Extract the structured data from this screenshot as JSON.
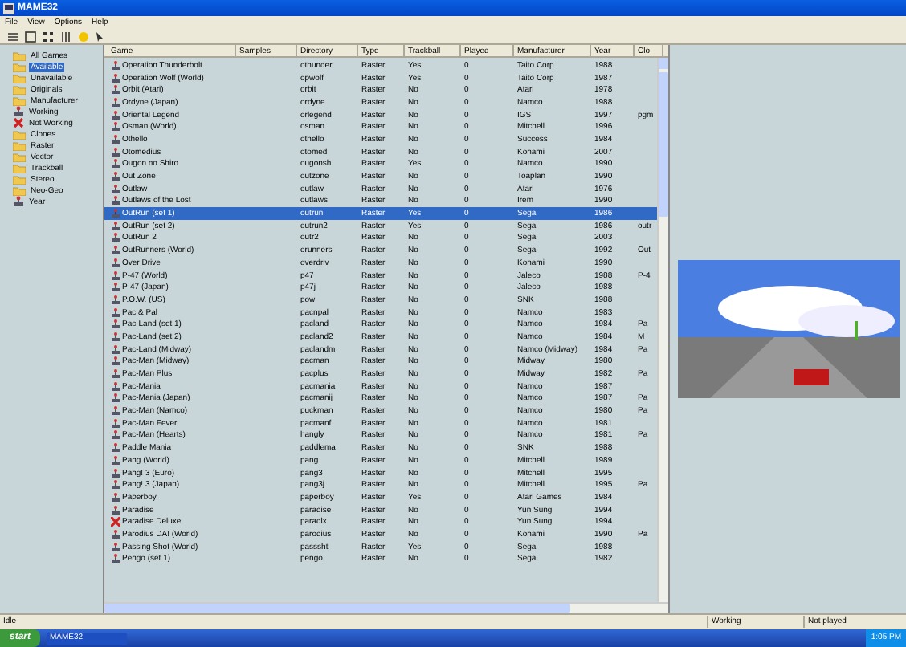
{
  "window": {
    "title": "MAME32"
  },
  "menu": [
    "File",
    "View",
    "Options",
    "Help"
  ],
  "tree": [
    {
      "label": "All Games",
      "selected": false,
      "kind": "folder"
    },
    {
      "label": "Available",
      "selected": true,
      "kind": "folder"
    },
    {
      "label": "Unavailable",
      "selected": false,
      "kind": "folder"
    },
    {
      "label": "Originals",
      "selected": false,
      "kind": "folder"
    },
    {
      "label": "Manufacturer",
      "selected": false,
      "kind": "folder"
    },
    {
      "label": "Working",
      "selected": false,
      "kind": "working"
    },
    {
      "label": "Not Working",
      "selected": false,
      "kind": "broken"
    },
    {
      "label": "Clones",
      "selected": false,
      "kind": "folder"
    },
    {
      "label": "Raster",
      "selected": false,
      "kind": "folder"
    },
    {
      "label": "Vector",
      "selected": false,
      "kind": "folder"
    },
    {
      "label": "Trackball",
      "selected": false,
      "kind": "folder"
    },
    {
      "label": "Stereo",
      "selected": false,
      "kind": "folder"
    },
    {
      "label": "Neo-Geo",
      "selected": false,
      "kind": "folder"
    },
    {
      "label": "Year",
      "selected": false,
      "kind": "working"
    }
  ],
  "columns": [
    "Game",
    "Samples",
    "Directory",
    "Type",
    "Trackball",
    "Played",
    "Manufacturer",
    "Year",
    "Clo"
  ],
  "rows": [
    {
      "game": "Operation Thunderbolt",
      "directory": "othunder",
      "type": "Raster",
      "trackball": "Yes",
      "played": "0",
      "manufacturer": "Taito Corp",
      "year": "1988",
      "kind": "working",
      "selected": false
    },
    {
      "game": "Operation Wolf (World)",
      "directory": "opwolf",
      "type": "Raster",
      "trackball": "Yes",
      "played": "0",
      "manufacturer": "Taito Corp",
      "year": "1987",
      "kind": "working",
      "selected": false
    },
    {
      "game": "Orbit (Atari)",
      "directory": "orbit",
      "type": "Raster",
      "trackball": "No",
      "played": "0",
      "manufacturer": "Atari",
      "year": "1978",
      "kind": "working",
      "selected": false
    },
    {
      "game": "Ordyne (Japan)",
      "directory": "ordyne",
      "type": "Raster",
      "trackball": "No",
      "played": "0",
      "manufacturer": "Namco",
      "year": "1988",
      "kind": "working",
      "selected": false
    },
    {
      "game": "Oriental Legend",
      "directory": "orlegend",
      "type": "Raster",
      "trackball": "No",
      "played": "0",
      "manufacturer": "IGS",
      "year": "1997",
      "clone_of": "pgm",
      "kind": "working",
      "selected": false
    },
    {
      "game": "Osman (World)",
      "directory": "osman",
      "type": "Raster",
      "trackball": "No",
      "played": "0",
      "manufacturer": "Mitchell",
      "year": "1996",
      "kind": "working",
      "selected": false
    },
    {
      "game": "Othello",
      "directory": "othello",
      "type": "Raster",
      "trackball": "No",
      "played": "0",
      "manufacturer": "Success",
      "year": "1984",
      "kind": "working",
      "selected": false
    },
    {
      "game": "Otomedius",
      "directory": "otomed",
      "type": "Raster",
      "trackball": "No",
      "played": "0",
      "manufacturer": "Konami",
      "year": "2007",
      "kind": "working",
      "selected": false
    },
    {
      "game": "Ougon no Shiro",
      "directory": "ougonsh",
      "type": "Raster",
      "trackball": "Yes",
      "played": "0",
      "manufacturer": "Namco",
      "year": "1990",
      "kind": "working",
      "selected": false
    },
    {
      "game": "Out Zone",
      "directory": "outzone",
      "type": "Raster",
      "trackball": "No",
      "played": "0",
      "manufacturer": "Toaplan",
      "year": "1990",
      "kind": "working",
      "selected": false
    },
    {
      "game": "Outlaw",
      "directory": "outlaw",
      "type": "Raster",
      "trackball": "No",
      "played": "0",
      "manufacturer": "Atari",
      "year": "1976",
      "kind": "working",
      "selected": false
    },
    {
      "game": "Outlaws of the Lost",
      "directory": "outlaws",
      "type": "Raster",
      "trackball": "No",
      "played": "0",
      "manufacturer": "Irem",
      "year": "1990",
      "kind": "working",
      "selected": false
    },
    {
      "game": "OutRun (set 1)",
      "directory": "outrun",
      "type": "Raster",
      "trackball": "Yes",
      "played": "0",
      "manufacturer": "Sega",
      "year": "1986",
      "kind": "working",
      "selected": true
    },
    {
      "game": "OutRun (set 2)",
      "directory": "outrun2",
      "type": "Raster",
      "trackball": "Yes",
      "played": "0",
      "manufacturer": "Sega",
      "year": "1986",
      "clone_of": "outr",
      "kind": "working",
      "selected": false
    },
    {
      "game": "OutRun 2",
      "directory": "outr2",
      "type": "Raster",
      "trackball": "No",
      "played": "0",
      "manufacturer": "Sega",
      "year": "2003",
      "kind": "working",
      "selected": false
    },
    {
      "game": "OutRunners (World)",
      "directory": "orunners",
      "type": "Raster",
      "trackball": "No",
      "played": "0",
      "manufacturer": "Sega",
      "year": "1992",
      "clone_of": "Out",
      "kind": "working",
      "selected": false
    },
    {
      "game": "Over Drive",
      "directory": "overdriv",
      "type": "Raster",
      "trackball": "No",
      "played": "0",
      "manufacturer": "Konami",
      "year": "1990",
      "kind": "working",
      "selected": false
    },
    {
      "game": "P-47 (World)",
      "directory": "p47",
      "type": "Raster",
      "trackball": "No",
      "played": "0",
      "manufacturer": "Jaleco",
      "year": "1988",
      "clone_of": "P-4",
      "kind": "working",
      "selected": false
    },
    {
      "game": "P-47 (Japan)",
      "directory": "p47j",
      "type": "Raster",
      "trackball": "No",
      "played": "0",
      "manufacturer": "Jaleco",
      "year": "1988",
      "kind": "working",
      "selected": false
    },
    {
      "game": "P.O.W. (US)",
      "directory": "pow",
      "type": "Raster",
      "trackball": "No",
      "played": "0",
      "manufacturer": "SNK",
      "year": "1988",
      "kind": "working",
      "selected": false
    },
    {
      "game": "Pac & Pal",
      "directory": "pacnpal",
      "type": "Raster",
      "trackball": "No",
      "played": "0",
      "manufacturer": "Namco",
      "year": "1983",
      "kind": "working",
      "selected": false
    },
    {
      "game": "Pac-Land (set 1)",
      "directory": "pacland",
      "type": "Raster",
      "trackball": "No",
      "played": "0",
      "manufacturer": "Namco",
      "year": "1984",
      "clone_of": "Pa",
      "kind": "working",
      "selected": false
    },
    {
      "game": "Pac-Land (set 2)",
      "directory": "pacland2",
      "type": "Raster",
      "trackball": "No",
      "played": "0",
      "manufacturer": "Namco",
      "year": "1984",
      "clone_of": "M",
      "kind": "working",
      "selected": false
    },
    {
      "game": "Pac-Land (Midway)",
      "directory": "paclandm",
      "type": "Raster",
      "trackball": "No",
      "played": "0",
      "manufacturer": "Namco (Midway)",
      "year": "1984",
      "clone_of": "Pa",
      "kind": "working",
      "selected": false
    },
    {
      "game": "Pac-Man (Midway)",
      "directory": "pacman",
      "type": "Raster",
      "trackball": "No",
      "played": "0",
      "manufacturer": "Midway",
      "year": "1980",
      "kind": "working",
      "selected": false
    },
    {
      "game": "Pac-Man Plus",
      "directory": "pacplus",
      "type": "Raster",
      "trackball": "No",
      "played": "0",
      "manufacturer": "Midway",
      "year": "1982",
      "clone_of": "Pa",
      "kind": "working",
      "selected": false
    },
    {
      "game": "Pac-Mania",
      "directory": "pacmania",
      "type": "Raster",
      "trackball": "No",
      "played": "0",
      "manufacturer": "Namco",
      "year": "1987",
      "kind": "working",
      "selected": false
    },
    {
      "game": "Pac-Mania (Japan)",
      "directory": "pacmanij",
      "type": "Raster",
      "trackball": "No",
      "played": "0",
      "manufacturer": "Namco",
      "year": "1987",
      "clone_of": "Pa",
      "kind": "working",
      "selected": false
    },
    {
      "game": "Pac-Man (Namco)",
      "directory": "puckman",
      "type": "Raster",
      "trackball": "No",
      "played": "0",
      "manufacturer": "Namco",
      "year": "1980",
      "clone_of": "Pa",
      "kind": "working",
      "selected": false
    },
    {
      "game": "Pac-Man Fever",
      "directory": "pacmanf",
      "type": "Raster",
      "trackball": "No",
      "played": "0",
      "manufacturer": "Namco",
      "year": "1981",
      "kind": "working",
      "selected": false
    },
    {
      "game": "Pac-Man (Hearts)",
      "directory": "hangly",
      "type": "Raster",
      "trackball": "No",
      "played": "0",
      "manufacturer": "Namco",
      "year": "1981",
      "clone_of": "Pa",
      "kind": "working",
      "selected": false
    },
    {
      "game": "Paddle Mania",
      "directory": "paddlema",
      "type": "Raster",
      "trackball": "No",
      "played": "0",
      "manufacturer": "SNK",
      "year": "1988",
      "kind": "working",
      "selected": false
    },
    {
      "game": "Pang (World)",
      "directory": "pang",
      "type": "Raster",
      "trackball": "No",
      "played": "0",
      "manufacturer": "Mitchell",
      "year": "1989",
      "kind": "working",
      "selected": false
    },
    {
      "game": "Pang! 3 (Euro)",
      "directory": "pang3",
      "type": "Raster",
      "trackball": "No",
      "played": "0",
      "manufacturer": "Mitchell",
      "year": "1995",
      "kind": "working",
      "selected": false
    },
    {
      "game": "Pang! 3 (Japan)",
      "directory": "pang3j",
      "type": "Raster",
      "trackball": "No",
      "played": "0",
      "manufacturer": "Mitchell",
      "year": "1995",
      "clone_of": "Pa",
      "kind": "working",
      "selected": false
    },
    {
      "game": "Paperboy",
      "directory": "paperboy",
      "type": "Raster",
      "trackball": "Yes",
      "played": "0",
      "manufacturer": "Atari Games",
      "year": "1984",
      "kind": "working",
      "selected": false
    },
    {
      "game": "Paradise",
      "directory": "paradise",
      "type": "Raster",
      "trackball": "No",
      "played": "0",
      "manufacturer": "Yun Sung",
      "year": "1994",
      "kind": "working",
      "selected": false
    },
    {
      "game": "Paradise Deluxe",
      "directory": "paradlx",
      "type": "Raster",
      "trackball": "No",
      "played": "0",
      "manufacturer": "Yun Sung",
      "year": "1994",
      "kind": "broken",
      "selected": false
    },
    {
      "game": "Parodius DA! (World)",
      "directory": "parodius",
      "type": "Raster",
      "trackball": "No",
      "played": "0",
      "manufacturer": "Konami",
      "year": "1990",
      "clone_of": "Pa",
      "kind": "working",
      "selected": false
    },
    {
      "game": "Passing Shot (World)",
      "directory": "passsht",
      "type": "Raster",
      "trackball": "Yes",
      "played": "0",
      "manufacturer": "Sega",
      "year": "1988",
      "kind": "working",
      "selected": false
    },
    {
      "game": "Pengo (set 1)",
      "directory": "pengo",
      "type": "Raster",
      "trackball": "No",
      "played": "0",
      "manufacturer": "Sega",
      "year": "1982",
      "kind": "working",
      "selected": false
    }
  ],
  "preview": {
    "caption": "Working",
    "played": "Not played"
  },
  "status_bar": {
    "text": "Idle"
  },
  "taskbar": {
    "start": "start",
    "task": "MAME32",
    "clock": "1:05 PM"
  }
}
